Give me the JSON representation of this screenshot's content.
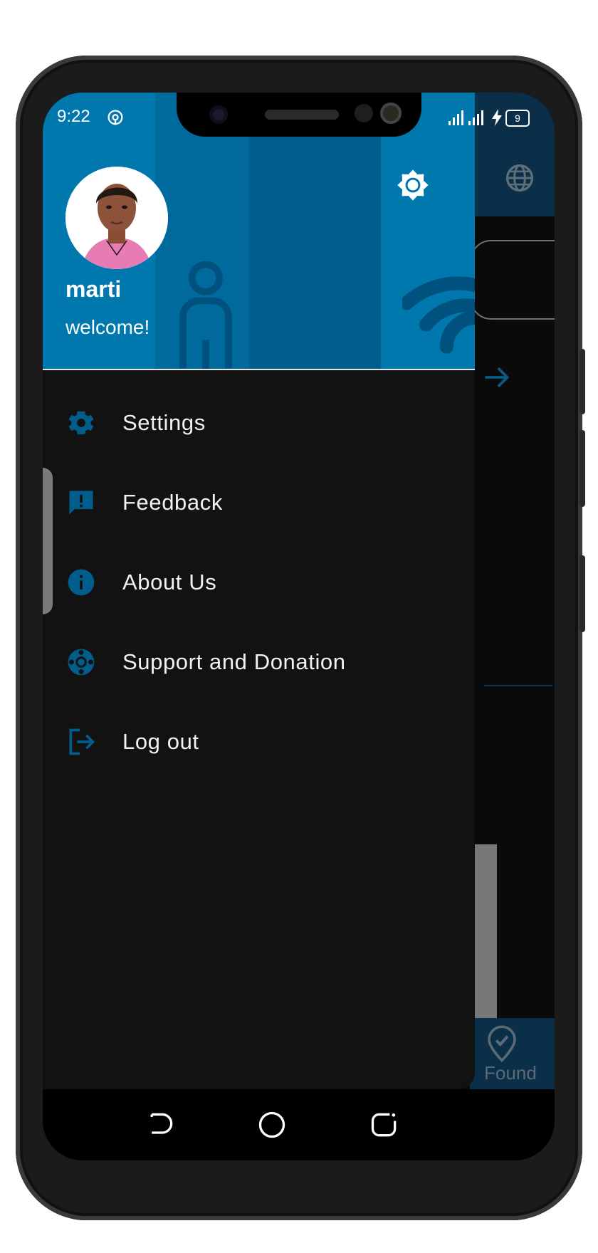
{
  "status_bar": {
    "time": "9:22",
    "battery": "9"
  },
  "drawer": {
    "user": {
      "name": "marti",
      "greeting": "welcome!"
    },
    "menu": [
      {
        "label": "Settings",
        "icon": "settings-gear-icon"
      },
      {
        "label": "Feedback",
        "icon": "feedback-icon"
      },
      {
        "label": "About Us",
        "icon": "info-icon"
      },
      {
        "label": "Support and Donation",
        "icon": "support-lifebuoy-icon"
      },
      {
        "label": "Log out",
        "icon": "logout-icon"
      }
    ]
  },
  "background_app": {
    "bottom_tab_label": "Found"
  },
  "colors": {
    "accent": "#0078ad",
    "accent_dark": "#005d8c",
    "drawer_bg": "#121212"
  }
}
